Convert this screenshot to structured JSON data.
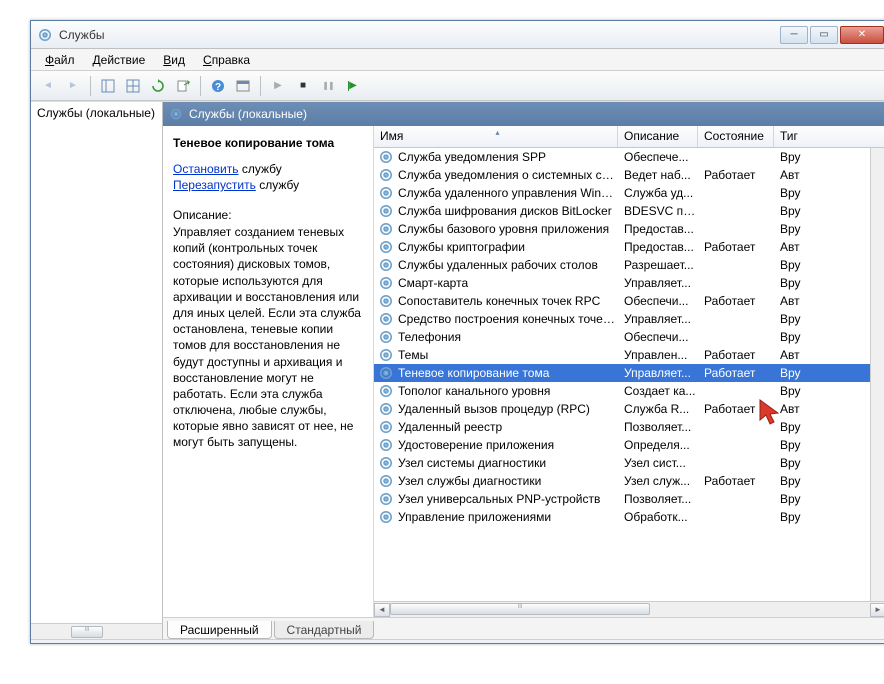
{
  "window": {
    "title": "Службы"
  },
  "menus": {
    "file": "Файл",
    "action": "Действие",
    "view": "Вид",
    "help": "Справка"
  },
  "sidebar": {
    "root": "Службы (локальные)"
  },
  "main_header": "Службы (локальные)",
  "detail": {
    "selected": "Теневое копирование тома",
    "stop": "Остановить",
    "restart": "Перезапустить",
    "suffix": " службу",
    "desc_heading": "Описание:",
    "desc": "Управляет созданием теневых копий (контрольных точек состояния) дисковых томов, которые используются для архивации и восстановления или для иных целей. Если эта служба остановлена, теневые копии томов для восстановления не будут доступны и архивация и восстановление могут не работать. Если эта служба отключена, любые службы, которые явно зависят от нее, не могут быть запущены."
  },
  "columns": {
    "name": "Имя",
    "desc": "Описание",
    "state": "Состояние",
    "type": "Тиг"
  },
  "tabs": {
    "ext": "Расширенный",
    "std": "Стандартный"
  },
  "rows": [
    {
      "n": "Служба уведомления SPP",
      "d": "Обеспече...",
      "s": "",
      "t": "Вру"
    },
    {
      "n": "Служба уведомления о системных соб...",
      "d": "Ведет наб...",
      "s": "Работает",
      "t": "Авт"
    },
    {
      "n": "Служба удаленного управления Windo...",
      "d": "Служба уд...",
      "s": "",
      "t": "Вру"
    },
    {
      "n": "Служба шифрования дисков BitLocker",
      "d": "BDESVC пр...",
      "s": "",
      "t": "Вру"
    },
    {
      "n": "Службы базового уровня приложения",
      "d": "Предостав...",
      "s": "",
      "t": "Вру"
    },
    {
      "n": "Службы криптографии",
      "d": "Предостав...",
      "s": "Работает",
      "t": "Авт"
    },
    {
      "n": "Службы удаленных рабочих столов",
      "d": "Разрешает...",
      "s": "",
      "t": "Вру"
    },
    {
      "n": "Смарт-карта",
      "d": "Управляет...",
      "s": "",
      "t": "Вру"
    },
    {
      "n": "Сопоставитель конечных точек RPC",
      "d": "Обеспечи...",
      "s": "Работает",
      "t": "Авт"
    },
    {
      "n": "Средство построения конечных точек ...",
      "d": "Управляет...",
      "s": "",
      "t": "Вру"
    },
    {
      "n": "Телефония",
      "d": "Обеспечи...",
      "s": "",
      "t": "Вру"
    },
    {
      "n": "Темы",
      "d": "Управлен...",
      "s": "Работает",
      "t": "Авт"
    },
    {
      "n": "Теневое копирование тома",
      "d": "Управляет...",
      "s": "Работает",
      "t": "Вру",
      "sel": true
    },
    {
      "n": "Тополог канального уровня",
      "d": "Создает ка...",
      "s": "",
      "t": "Вру"
    },
    {
      "n": "Удаленный вызов процедур (RPC)",
      "d": "Служба R...",
      "s": "Работает",
      "t": "Авт"
    },
    {
      "n": "Удаленный реестр",
      "d": "Позволяет...",
      "s": "",
      "t": "Вру"
    },
    {
      "n": "Удостоверение приложения",
      "d": "Определя...",
      "s": "",
      "t": "Вру"
    },
    {
      "n": "Узел системы диагностики",
      "d": "Узел сист...",
      "s": "",
      "t": "Вру"
    },
    {
      "n": "Узел службы диагностики",
      "d": "Узел служ...",
      "s": "Работает",
      "t": "Вру"
    },
    {
      "n": "Узел универсальных PNP-устройств",
      "d": "Позволяет...",
      "s": "",
      "t": "Вру"
    },
    {
      "n": "Управление приложениями",
      "d": "Обработк...",
      "s": "",
      "t": "Вру"
    }
  ]
}
